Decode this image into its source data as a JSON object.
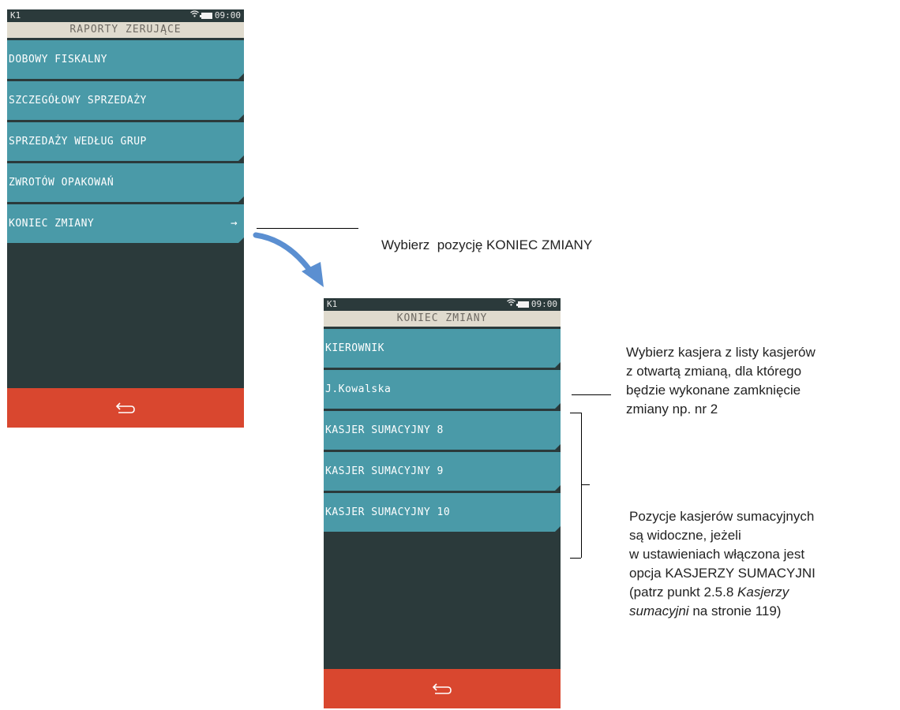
{
  "screen1": {
    "status_left": "K1",
    "status_time": "09:00",
    "title": "RAPORTY ZERUJĄCE",
    "items": [
      {
        "label": "DOBOWY FISKALNY"
      },
      {
        "label": "SZCZEGÓŁOWY SPRZEDAŻY"
      },
      {
        "label": "SPRZEDAŻY WEDŁUG GRUP"
      },
      {
        "label": "ZWROTÓW OPAKOWAŃ"
      },
      {
        "label": "KONIEC ZMIANY",
        "arrow": "→"
      }
    ],
    "back_icon": "return-arrow-icon"
  },
  "screen2": {
    "status_left": "K1",
    "status_time": "09:00",
    "title": "KONIEC ZMIANY",
    "items": [
      {
        "label": "KIEROWNIK"
      },
      {
        "label": "J.Kowalska"
      },
      {
        "label": "KASJER SUMACYJNY 8"
      },
      {
        "label": "KASJER SUMACYJNY 9"
      },
      {
        "label": "KASJER SUMACYJNY 10"
      }
    ],
    "back_icon": "return-arrow-icon"
  },
  "annotations": {
    "select_shift_end": "Wybierz  pozycję KONIEC ZMIANY",
    "select_cashier": [
      "Wybierz kasjera z listy kasjerów",
      "z otwartą zmianą, dla którego",
      "będzie wykonane zamknięcie",
      "zmiany np. nr 2"
    ],
    "summary_cashiers": {
      "line1": "Pozycje kasjerów sumacyjnych",
      "line2": "są widoczne, jeżeli",
      "line3": "w ustawieniach włączona jest",
      "line4": "opcja KASJERZY SUMACYJNI",
      "line5": "(patrz punkt 2.5.8 ",
      "line5_italic": "Kasjerzy",
      "line6_italic": "sumacyjni",
      "line6_rest": " na stronie 119)"
    }
  },
  "colors": {
    "screen_bg": "#2b3a3b",
    "title_bg": "#e0dbce",
    "menu_item": "#4a9aa8",
    "back_bar": "#d9472f",
    "flow_arrow": "#5b8fd1"
  }
}
